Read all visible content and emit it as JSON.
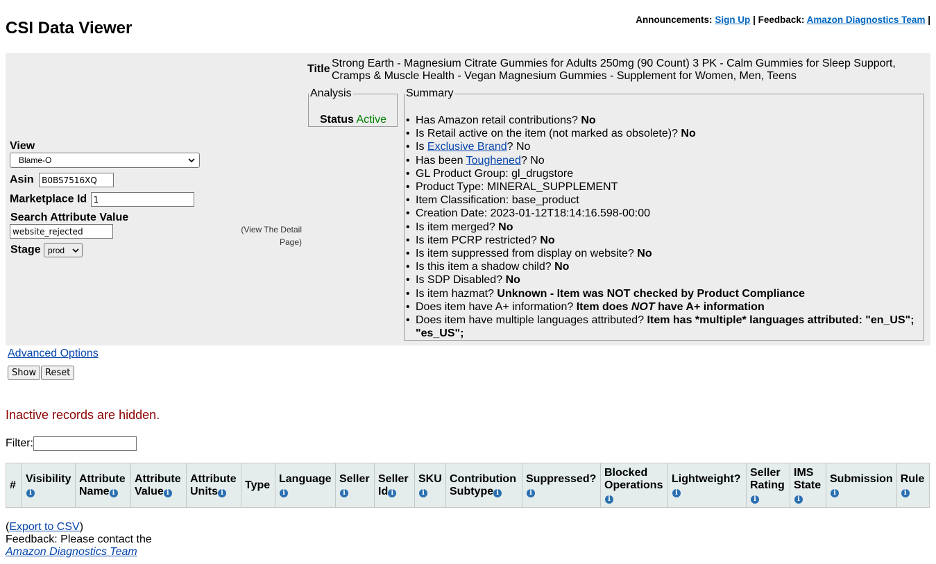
{
  "header": {
    "announcements_label": "Announcements:",
    "signup_link": "Sign Up",
    "sep1": "|",
    "feedback_label": "Feedback:",
    "feedback_link": "Amazon Diagnostics Team",
    "sep2": "|"
  },
  "app_title": "CSI Data Viewer",
  "form": {
    "view_label": "View",
    "view_value": "Blame-O",
    "asin_label": "Asin",
    "asin_value": "B0BS7516XQ",
    "marketplace_label": "Marketplace Id",
    "marketplace_value": "1",
    "search_label": "Search Attribute Value",
    "search_value": "website_rejected",
    "stage_label": "Stage",
    "stage_value": "prod"
  },
  "detail_page_link": "(View The Detail Page)",
  "title_label": "Title",
  "title_value": "Strong Earth - Magnesium Citrate Gummies for Adults 250mg (90 Count) 3 PK - Calm Gummies for Sleep Support, Cramps & Muscle Health - Vegan Magnesium Gummies - Supplement for Women, Men, Teens",
  "analysis": {
    "legend": "Analysis",
    "status_label": "Status",
    "status_value": "Active",
    "status_color": "#008000"
  },
  "summary": {
    "legend": "Summary",
    "items": [
      {
        "q": "Has Amazon retail contributions?",
        "a": "No"
      },
      {
        "q": "Is Retail active on the item (not marked as obsolete)?",
        "a": "No"
      },
      {
        "q_pre": "Is",
        "link": "Exclusive Brand",
        "q_post": "? No"
      },
      {
        "q_pre": "Has been",
        "link": "Toughened",
        "q_post": "? No"
      },
      {
        "q": "GL Product Group: gl_drugstore"
      },
      {
        "q": "Product Type: MINERAL_SUPPLEMENT"
      },
      {
        "q": "Item Classification: base_product"
      },
      {
        "q": "Creation Date: 2023-01-12T18:14:16.598-00:00"
      },
      {
        "q": "Is item merged?",
        "a": "No"
      },
      {
        "q": "Is item PCRP restricted?",
        "a": "No"
      },
      {
        "q": "Is item suppressed from display on website?",
        "a": "No"
      },
      {
        "q": "Is this item a shadow child?",
        "a": "No"
      },
      {
        "q": "Is SDP Disabled?",
        "a": "No"
      },
      {
        "q": "Is item hazmat?",
        "a": "Unknown - Item was NOT checked by Product Compliance"
      },
      {
        "q": "Does item have A+ information?",
        "a_pre": "Item does",
        "a_em": "NOT",
        "a_post": "have A+ information"
      },
      {
        "q": "Does item have multiple languages attributed?",
        "a": "Item has *multiple* languages attributed: \"en_US\"; \"es_US\";"
      }
    ]
  },
  "advanced_options": "Advanced Options",
  "buttons": {
    "show": "Show",
    "reset": "Reset"
  },
  "inactive_notice": "Inactive records are hidden.",
  "filter_label": "Filter:",
  "table": {
    "columns": [
      {
        "l1": "#",
        "info": false
      },
      {
        "l1": "Visibility",
        "info": true
      },
      {
        "l1": "Attribute",
        "l2": "Name",
        "info": true,
        "inline": true
      },
      {
        "l1": "Attribute",
        "l2": "Value",
        "info": true,
        "inline": true
      },
      {
        "l1": "Attribute",
        "l2": "Units",
        "info": true,
        "inline": true
      },
      {
        "l1": "Type",
        "info": false
      },
      {
        "l1": "Language",
        "info": true
      },
      {
        "l1": "Seller",
        "info": true
      },
      {
        "l1": "Seller",
        "l2": "Id",
        "info": true,
        "inline": true
      },
      {
        "l1": "SKU",
        "info": true
      },
      {
        "l1": "Contribution",
        "l2": "Subtype",
        "info": true,
        "inline": true
      },
      {
        "l1": "Suppressed?",
        "info": true
      },
      {
        "l1": "Blocked",
        "l2": "Operations",
        "info": true
      },
      {
        "l1": "Lightweight?",
        "info": true
      },
      {
        "l1": "Seller",
        "l2": "Rating",
        "info": true
      },
      {
        "l1": "IMS",
        "l2": "State",
        "info": true
      },
      {
        "l1": "Submission",
        "info": true
      },
      {
        "l1": "Rule",
        "info": true
      }
    ]
  },
  "export": {
    "open": "(",
    "link": "Export to CSV",
    "close": ")",
    "feedback_text": "Feedback: Please contact the",
    "team_link": "Amazon Diagnostics Team"
  },
  "icons": {
    "info": "info-icon",
    "dropdown": "chevron-down-icon"
  },
  "colors": {
    "panel_bg": "#ededed",
    "header_bg": "#e4ecec",
    "link": "#0645ad",
    "notice": "#8b0000"
  }
}
